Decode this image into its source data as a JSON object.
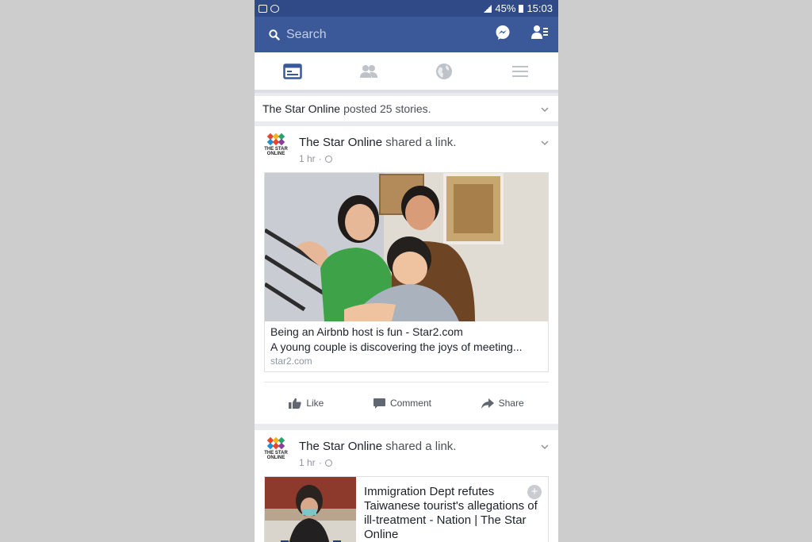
{
  "status_bar": {
    "battery": "45%",
    "time": "15:03"
  },
  "search": {
    "placeholder": "Search"
  },
  "notice": {
    "page_name": "The Star Online",
    "suffix": "posted 25 stories."
  },
  "avatar_text": "THE STAR ONLINE",
  "posts": [
    {
      "author": "The Star Online",
      "action": "shared a link.",
      "time": "1 hr",
      "link": {
        "title": "Being an Airbnb host is fun - Star2.com",
        "description": "A young couple is discovering the joys of meeting...",
        "domain": "star2.com"
      }
    },
    {
      "author": "The Star Online",
      "action": "shared a link.",
      "time": "1 hr",
      "link": {
        "title": "Immigration Dept refutes Taiwanese tourist's allegations of ill-treatment - Nation | The Star Online"
      }
    }
  ],
  "actions": {
    "like": "Like",
    "comment": "Comment",
    "share": "Share"
  },
  "colors": {
    "brand": "#3b5998",
    "status_bar": "#2f4a86"
  },
  "tabs": [
    "news-feed",
    "friends",
    "notifications",
    "menu"
  ]
}
